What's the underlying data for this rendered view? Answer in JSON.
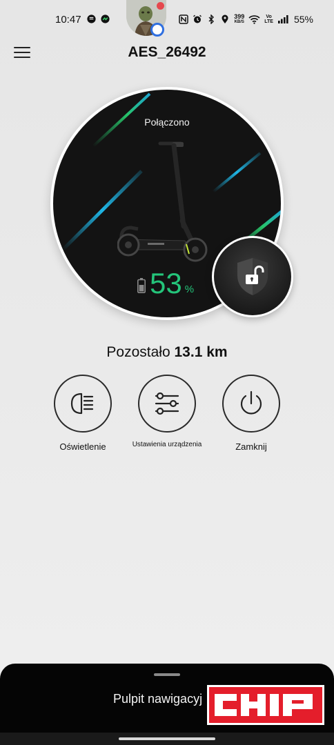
{
  "status_bar": {
    "time": "10:47",
    "speed_value": "399",
    "speed_unit": "KB/S",
    "volte_top": "Vo",
    "volte_bottom": "LTE",
    "battery": "55%"
  },
  "header": {
    "title": "AES_26492"
  },
  "hero": {
    "status": "Połączono",
    "battery_value": "53",
    "battery_unit": "%",
    "lock_state": "unlocked"
  },
  "range": {
    "prefix": "Pozostało",
    "value": "13.1 km"
  },
  "actions": [
    {
      "label": "Oświetlenie",
      "icon": "headlight-icon"
    },
    {
      "label": "Ustawienia urządzenia",
      "icon": "sliders-icon"
    },
    {
      "label": "Zamknij",
      "icon": "power-icon"
    }
  ],
  "bottom_sheet": {
    "title": "Pulpit nawigacyj"
  },
  "watermark": {
    "text": "CHIP"
  },
  "colors": {
    "accent_green": "#24c47a",
    "hero_background": "#131313",
    "streak_cyan": "#1fb6e6",
    "streak_green": "#27c46a",
    "watermark_red": "#e41e2b"
  }
}
